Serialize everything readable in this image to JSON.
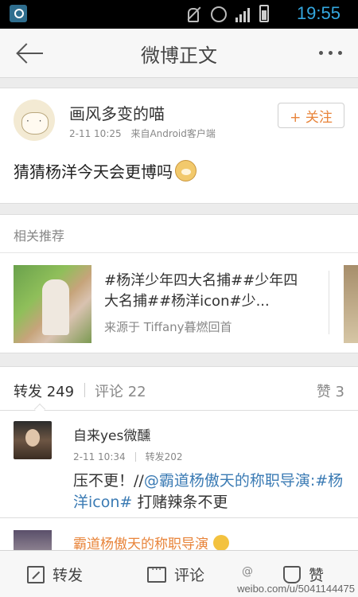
{
  "status_bar": {
    "time": "19:55",
    "icons": [
      "app-icon",
      "mute-icon",
      "alarm-icon",
      "signal-icon",
      "battery-icon"
    ]
  },
  "header": {
    "title": "微博正文",
    "back_icon": "back-arrow-icon",
    "more_icon": "more-icon"
  },
  "post": {
    "username": "画风多变的喵",
    "date": "2-11 10:25",
    "source": "来自Android客户端",
    "follow_label": "+ 关注",
    "text": "猜猜杨洋今天会更博吗",
    "emoji": "doge-icon"
  },
  "related": {
    "heading": "相关推荐",
    "card_title": "#杨洋少年四大名捕##少年四大名捕##杨洋icon#少...",
    "card_source": "来源于 Tiffany暮燃回首"
  },
  "tabs": {
    "repost": "转发 249",
    "comment": "评论 22",
    "like": "赞 3"
  },
  "comment": {
    "name": "自来yes微醺",
    "date": "2-11 10:34",
    "repost_count": "转发202",
    "text_prefix": "压不更！//",
    "mention": "@霸道杨傲天的称职导演",
    "text_colon": ":",
    "hashtag": "#杨洋icon#",
    "text_suffix": " 打赌辣条不更"
  },
  "next_comment": {
    "name": "霸道杨傲天的称职导演"
  },
  "bottom_bar": {
    "repost_label": "转发",
    "comment_label": "评论",
    "like_label": "赞"
  },
  "watermark": {
    "brand": "@",
    "url": "weibo.com/u/5041144475"
  },
  "colors": {
    "accent_orange": "#e8843a",
    "link_blue": "#3b7bb4",
    "time_blue": "#34a8e0"
  }
}
